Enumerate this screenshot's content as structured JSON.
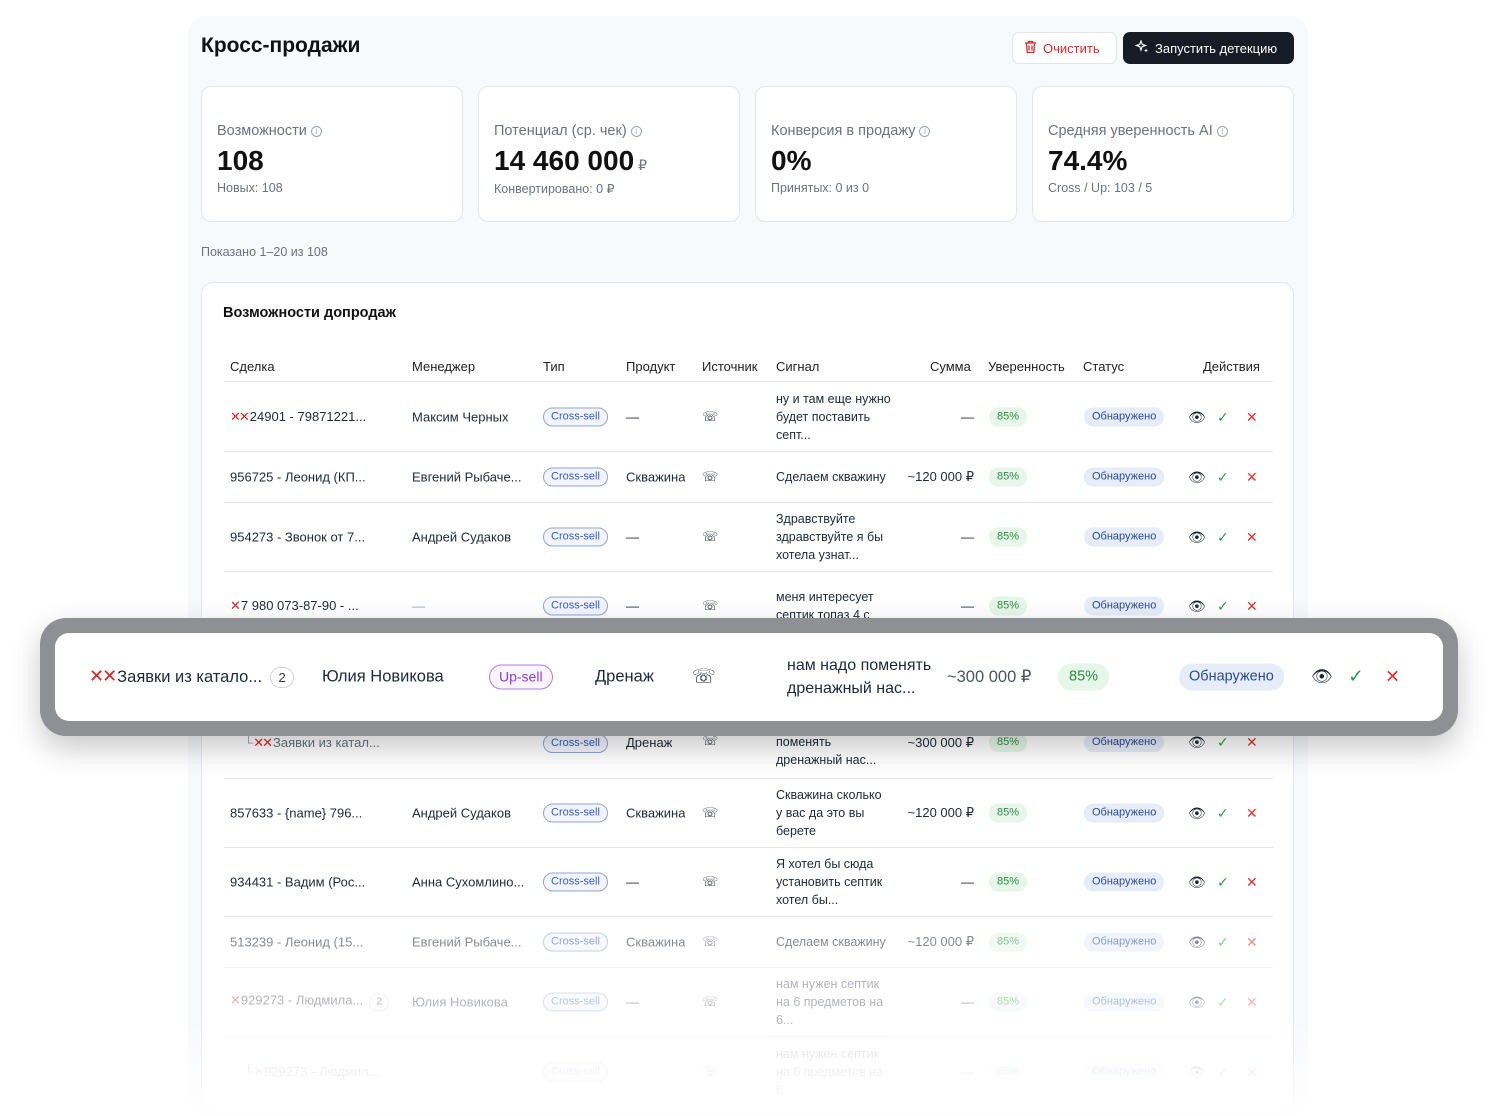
{
  "page": {
    "title": "Кросс-продажи",
    "clear_label": "Очистить",
    "run_label": "Запустить детекцию"
  },
  "stats": [
    {
      "label": "Возможности",
      "value": "108",
      "currency": "",
      "sub": "Новых: 108"
    },
    {
      "label": "Потенциал (ср. чек)",
      "value": "14 460 000",
      "currency": "₽",
      "sub": "Конвертировано: 0 ₽"
    },
    {
      "label": "Конверсия в продажу",
      "value": "0%",
      "currency": "",
      "sub": "Принятых: 0 из 0"
    },
    {
      "label": "Средняя уверенность AI",
      "value": "74.4%",
      "currency": "",
      "sub": "Cross / Up: 103 / 5"
    }
  ],
  "shown": "Показано 1–20 из 108",
  "table": {
    "title": "Возможности допродаж",
    "headers": {
      "deal": "Сделка",
      "manager": "Менеджер",
      "type": "Тип",
      "product": "Продукт",
      "source": "Источник",
      "signal": "Сигнал",
      "sum": "Сумма",
      "confidence": "Уверенность",
      "status": "Статус",
      "actions": "Действия"
    },
    "rows": [
      {
        "deal": "24901 - 79871221...",
        "manager": "Максим Черных",
        "type": "Cross-sell",
        "product": "—",
        "signal": "ну и там еще нужно будет поставить септ...",
        "sum": "—",
        "confidence": "85%",
        "status": "Обнаружено"
      },
      {
        "deal": "956725 - Леонид (КП...",
        "manager": "Евгений Рыбаче...",
        "type": "Cross-sell",
        "product": "Скважина",
        "signal": "Сделаем скважину",
        "sum": "~120 000 ₽",
        "confidence": "85%",
        "status": "Обнаружено"
      },
      {
        "deal": "954273 - Звонок от 7...",
        "manager": "Андрей Судаков",
        "type": "Cross-sell",
        "product": "—",
        "signal": "Здравствуйте здравствуйте я бы хотела узнат...",
        "sum": "—",
        "confidence": "85%",
        "status": "Обнаружено"
      },
      {
        "deal": "7 980 073-87-90 - ...",
        "manager": "—",
        "type": "Cross-sell",
        "product": "—",
        "signal": "меня интересует септик топаз 4 с",
        "sum": "—",
        "confidence": "85%",
        "status": "Обнаружено"
      },
      {
        "deal": "Заявки из катал...",
        "manager": "",
        "type": "Cross-sell",
        "product": "Дренаж",
        "signal": "поменять дренажный нас...",
        "sum": "~300 000 ₽",
        "confidence": "85%",
        "status": "Обнаружено"
      },
      {
        "deal": "857633 - {name} 796...",
        "manager": "Андрей Судаков",
        "type": "Cross-sell",
        "product": "Скважина",
        "signal": "Скважина сколько у вас да это вы берете",
        "sum": "~120 000 ₽",
        "confidence": "85%",
        "status": "Обнаружено"
      },
      {
        "deal": "934431 - Вадим (Рос...",
        "manager": "Анна Сухомлино...",
        "type": "Cross-sell",
        "product": "—",
        "signal": "Я хотел бы сюда установить септик хотел бы...",
        "sum": "—",
        "confidence": "85%",
        "status": "Обнаружено"
      },
      {
        "deal": "513239 - Леонид (15...",
        "manager": "Евгений Рыбаче...",
        "type": "Cross-sell",
        "product": "Скважина",
        "signal": "Сделаем скважину",
        "sum": "~120 000 ₽",
        "confidence": "85%",
        "status": "Обнаружено"
      },
      {
        "deal": "929273 - Людмила...",
        "badge": "2",
        "manager": "Юлия Новикова",
        "type": "Cross-sell",
        "product": "—",
        "signal": "нам нужен септик на 6 предметов на 6...",
        "sum": "—",
        "confidence": "85%",
        "status": "Обнаружено"
      },
      {
        "deal": "929273 - Людмил...",
        "manager": "",
        "type": "Cross-sell",
        "product": "",
        "signal": "нам нужен септик на 6 предметов на 6",
        "sum": "—",
        "confidence": "85%",
        "status": "Обнаружено"
      }
    ]
  },
  "highlight": {
    "deal": "Заявки из катало...",
    "badge": "2",
    "manager": "Юлия Новикова",
    "type": "Up-sell",
    "product": "Дренаж",
    "signal": "нам надо поменять дренажный нас...",
    "sum": "~300 000 ₽",
    "confidence": "85%",
    "status": "Обнаружено"
  }
}
